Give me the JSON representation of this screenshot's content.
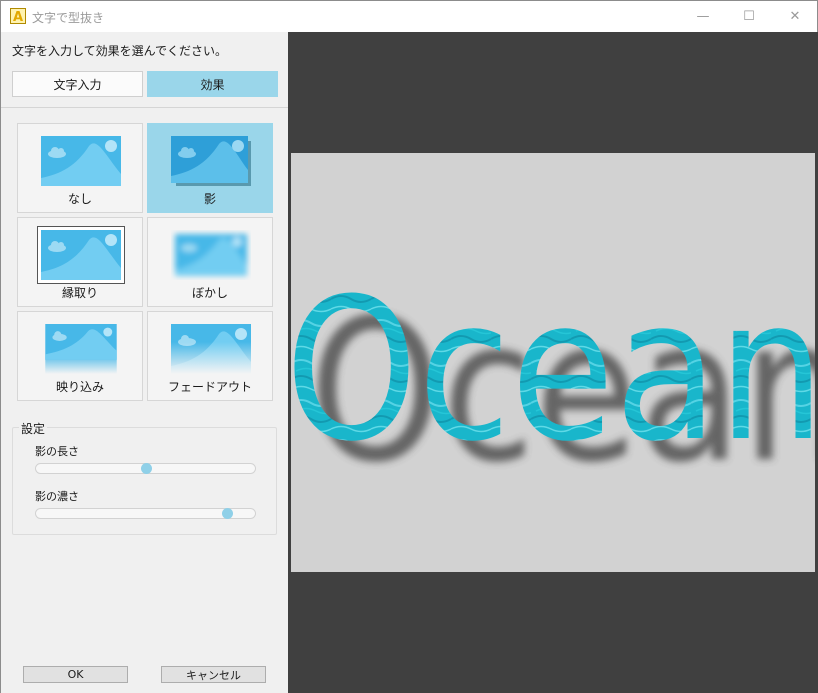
{
  "window": {
    "title": "文字で型抜き",
    "minimize_glyph": "—",
    "maximize_glyph": "☐",
    "close_glyph": "✕"
  },
  "panel": {
    "instruction": "文字を入力して効果を選んでください。",
    "tabs": [
      {
        "label": "文字入力",
        "selected": false
      },
      {
        "label": "効果",
        "selected": true
      }
    ]
  },
  "effects": [
    {
      "label": "なし",
      "icon": "plain-image-icon",
      "selected": false
    },
    {
      "label": "影",
      "icon": "shadow-image-icon",
      "selected": true
    },
    {
      "label": "縁取り",
      "icon": "border-image-icon",
      "selected": false
    },
    {
      "label": "ぼかし",
      "icon": "blur-image-icon",
      "selected": false
    },
    {
      "label": "映り込み",
      "icon": "reflection-image-icon",
      "selected": false
    },
    {
      "label": "フェードアウト",
      "icon": "fade-image-icon",
      "selected": false
    }
  ],
  "settings": {
    "title": "設定",
    "shadow_length": {
      "label": "影の長さ",
      "value_fraction": 0.5
    },
    "shadow_density": {
      "label": "影の濃さ",
      "value_fraction": 0.87
    }
  },
  "buttons": {
    "ok_label": "OK",
    "cancel_label": "キャンセル"
  },
  "preview": {
    "text": "Ocean",
    "canvas_color": "#d2d2d2",
    "text_color": "#1ec0d2"
  },
  "colors": {
    "accent": "#9ad6ea",
    "thumb_blue": "#47b8e8",
    "preview_bg": "#404040"
  }
}
